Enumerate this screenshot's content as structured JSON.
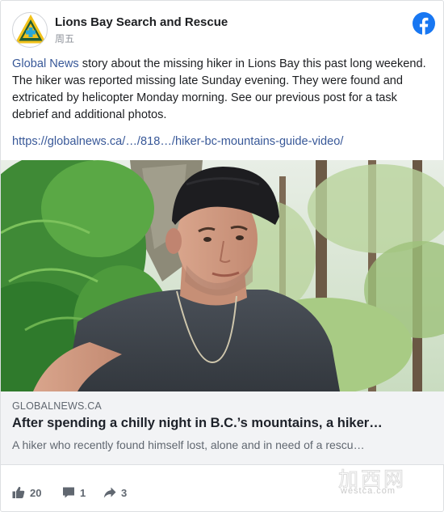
{
  "post": {
    "page_name": "Lions Bay Search and Rescue",
    "time": "周五",
    "text_link": "Global News",
    "text_body": " story about the missing hiker in Lions Bay this past long weekend. The hiker was reported missing late Sunday evening. They were found and extricated by helicopter Monday morning. See our previous post for a task debrief and additional photos.",
    "url": "https://globalnews.ca/…/818…/hiker-bc-mountains-guide-video/"
  },
  "preview": {
    "domain": "GLOBALNEWS.CA",
    "title": "After spending a chilly night in B.C.’s mountains, a hiker…",
    "description": "A hiker who recently found himself lost, alone and in need of a rescu…"
  },
  "actions": {
    "likes": "20",
    "comments": "1",
    "shares": "3"
  },
  "watermark": {
    "cn": "加西网",
    "en": "westca.com"
  },
  "icons": {
    "avatar": "lions-bay-sar-logo-icon",
    "brand": "facebook-icon",
    "like": "thumbs-up-icon",
    "comment": "comment-icon",
    "share": "share-arrow-icon"
  },
  "colors": {
    "link": "#385898",
    "facebook": "#1877f2",
    "preview_bg": "#f2f3f5",
    "muted": "#606770"
  }
}
